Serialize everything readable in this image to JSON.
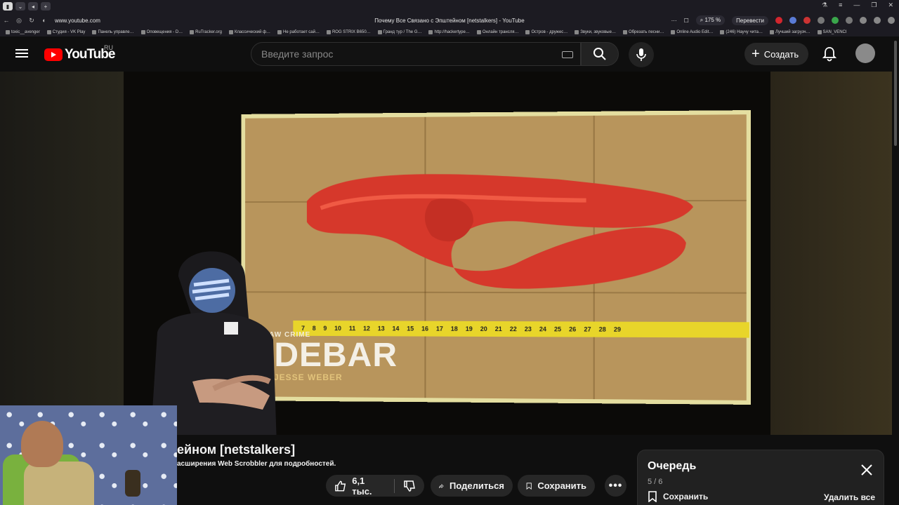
{
  "browser": {
    "url": "www.youtube.com",
    "page_title": "Почему Все Связано с Эпштейном [netstalkers] - YouTube",
    "zoom": "175 %",
    "translate": "Перевести",
    "bookmarks": [
      "toxic__avenger",
      "Студия - VK Play",
      "Панель управле…",
      "Оповещения - D…",
      "RuTracker.org",
      "Классический ф…",
      "Не работает сай…",
      "ROG STRIX B650…",
      "Гранд тур / The G…",
      "http://hackertype…",
      "Онлайн трансля…",
      "Остров - дружес…",
      "Звуки, звуковые…",
      "Обрезать песни…",
      "Online Audio Edit…",
      "(246) Научу чита…",
      "Лучший загрузч…",
      "SAN_VENCI"
    ]
  },
  "youtube": {
    "logo": "YouTube",
    "region": "RU",
    "search_placeholder": "Введите запрос",
    "create_label": "Создать"
  },
  "video": {
    "overlay_small": "LAW CRIME",
    "overlay_big": "IDEBAR",
    "overlay_sub": "H JESSE WEBER",
    "ruler_numbers": [
      "7",
      "8",
      "9",
      "10",
      "11",
      "12",
      "13",
      "14",
      "15",
      "16",
      "17",
      "18",
      "19",
      "20",
      "21",
      "22",
      "23",
      "24",
      "25",
      "26",
      "27",
      "28",
      "29"
    ]
  },
  "details": {
    "title_visible": "ейном [netstalkers]",
    "description_visible": "асширения Web Scrobbler для подробностей.",
    "likes": "6,1 тыс.",
    "share_label": "Поделиться",
    "save_label": "Сохранить"
  },
  "queue": {
    "title": "Очередь",
    "position": "5 / 6",
    "save_label": "Сохранить",
    "clear_label": "Удалить все"
  },
  "colors": {
    "background": "#0f0f0f",
    "brand_red": "#ff0000",
    "button_bg": "#272727",
    "ruler_yellow": "#e8d52a",
    "cloth_red": "#d6382b"
  }
}
